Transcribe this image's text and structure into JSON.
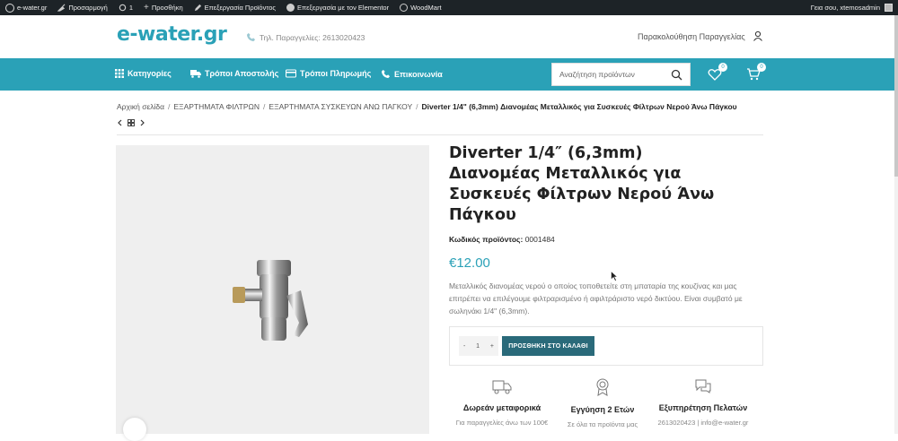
{
  "admin_bar": {
    "site": "e-water.gr",
    "customize": "Προσαρμογή",
    "updates": "1",
    "new": "Προσθήκη",
    "edit_product": "Επεξεργασία Προϊόντος",
    "elementor": "Επεξεργασία με τον Elementor",
    "woodmart": "WoodMart",
    "greeting": "Γεια σου, xtemosadmin"
  },
  "header": {
    "logo": "e-water.gr",
    "phone": "Τηλ. Παραγγελίες: 2613020423",
    "track_order": "Παρακολούθηση Παραγγελίας"
  },
  "nav": {
    "categories": "Κατηγορίες",
    "shipping": "Τρόποι Αποστολής",
    "payment": "Τρόποι Πληρωμής",
    "contact": "Επικοινωνία",
    "search_placeholder": "Αναζήτηση προϊόντων",
    "wishlist_count": "0",
    "cart_count": "0"
  },
  "breadcrumb": {
    "home": "Αρχική σελίδα",
    "cat1": "ΕΞΑΡΤΗΜΑΤΑ ΦΙΛΤΡΩΝ",
    "cat2": "ΕΞΑΡΤΗΜΑΤΑ ΣΥΣΚΕΥΩΝ ΑΝΩ ΠΑΓΚΟΥ",
    "current": "Diverter 1/4\" (6,3mm) Διανομέας Μεταλλικός για Συσκευές Φίλτρων Νερού Άνω Πάγκου"
  },
  "product": {
    "title": "Diverter 1/4″ (6,3mm) Διανομέας Μεταλλικός για Συσκευές Φίλτρων Νερού Άνω Πάγκου",
    "sku_label": "Κωδικός προϊόντος:",
    "sku": "0001484",
    "price": "€12.00",
    "description": "Μεταλλικός διανομέας νερού ο οποίος τοποθετείτε στη μπαταρία της κουζίνας και μας επιτρέπει να επιλέγουμε φιλτραρισμένο ή αφιλτράριστο νερό δικτύου. Είναι συμβατό με σωληνάκι 1/4\" (6,3mm).",
    "qty_minus": "-",
    "qty": "1",
    "qty_plus": "+",
    "add_to_cart": "ΠΡΟΣΘΗΚΗ ΣΤΟ ΚΑΛΑΘΙ"
  },
  "features": [
    {
      "title": "Δωρεάν μεταφορικά",
      "sub": "Για παραγγελίες άνω των 100€",
      "icon": "truck-icon"
    },
    {
      "title": "Εγγύηση 2 Ετών",
      "sub": "Σε όλα τα προϊόντα μας",
      "icon": "award-icon"
    },
    {
      "title": "Εξυπηρέτηση Πελατών",
      "sub": "2613020423 | info@e-water.gr",
      "icon": "chat-icon"
    }
  ],
  "colors": {
    "brand": "#2aa1b7",
    "button": "#2a6a7a",
    "admin_bar": "#1d2327"
  }
}
